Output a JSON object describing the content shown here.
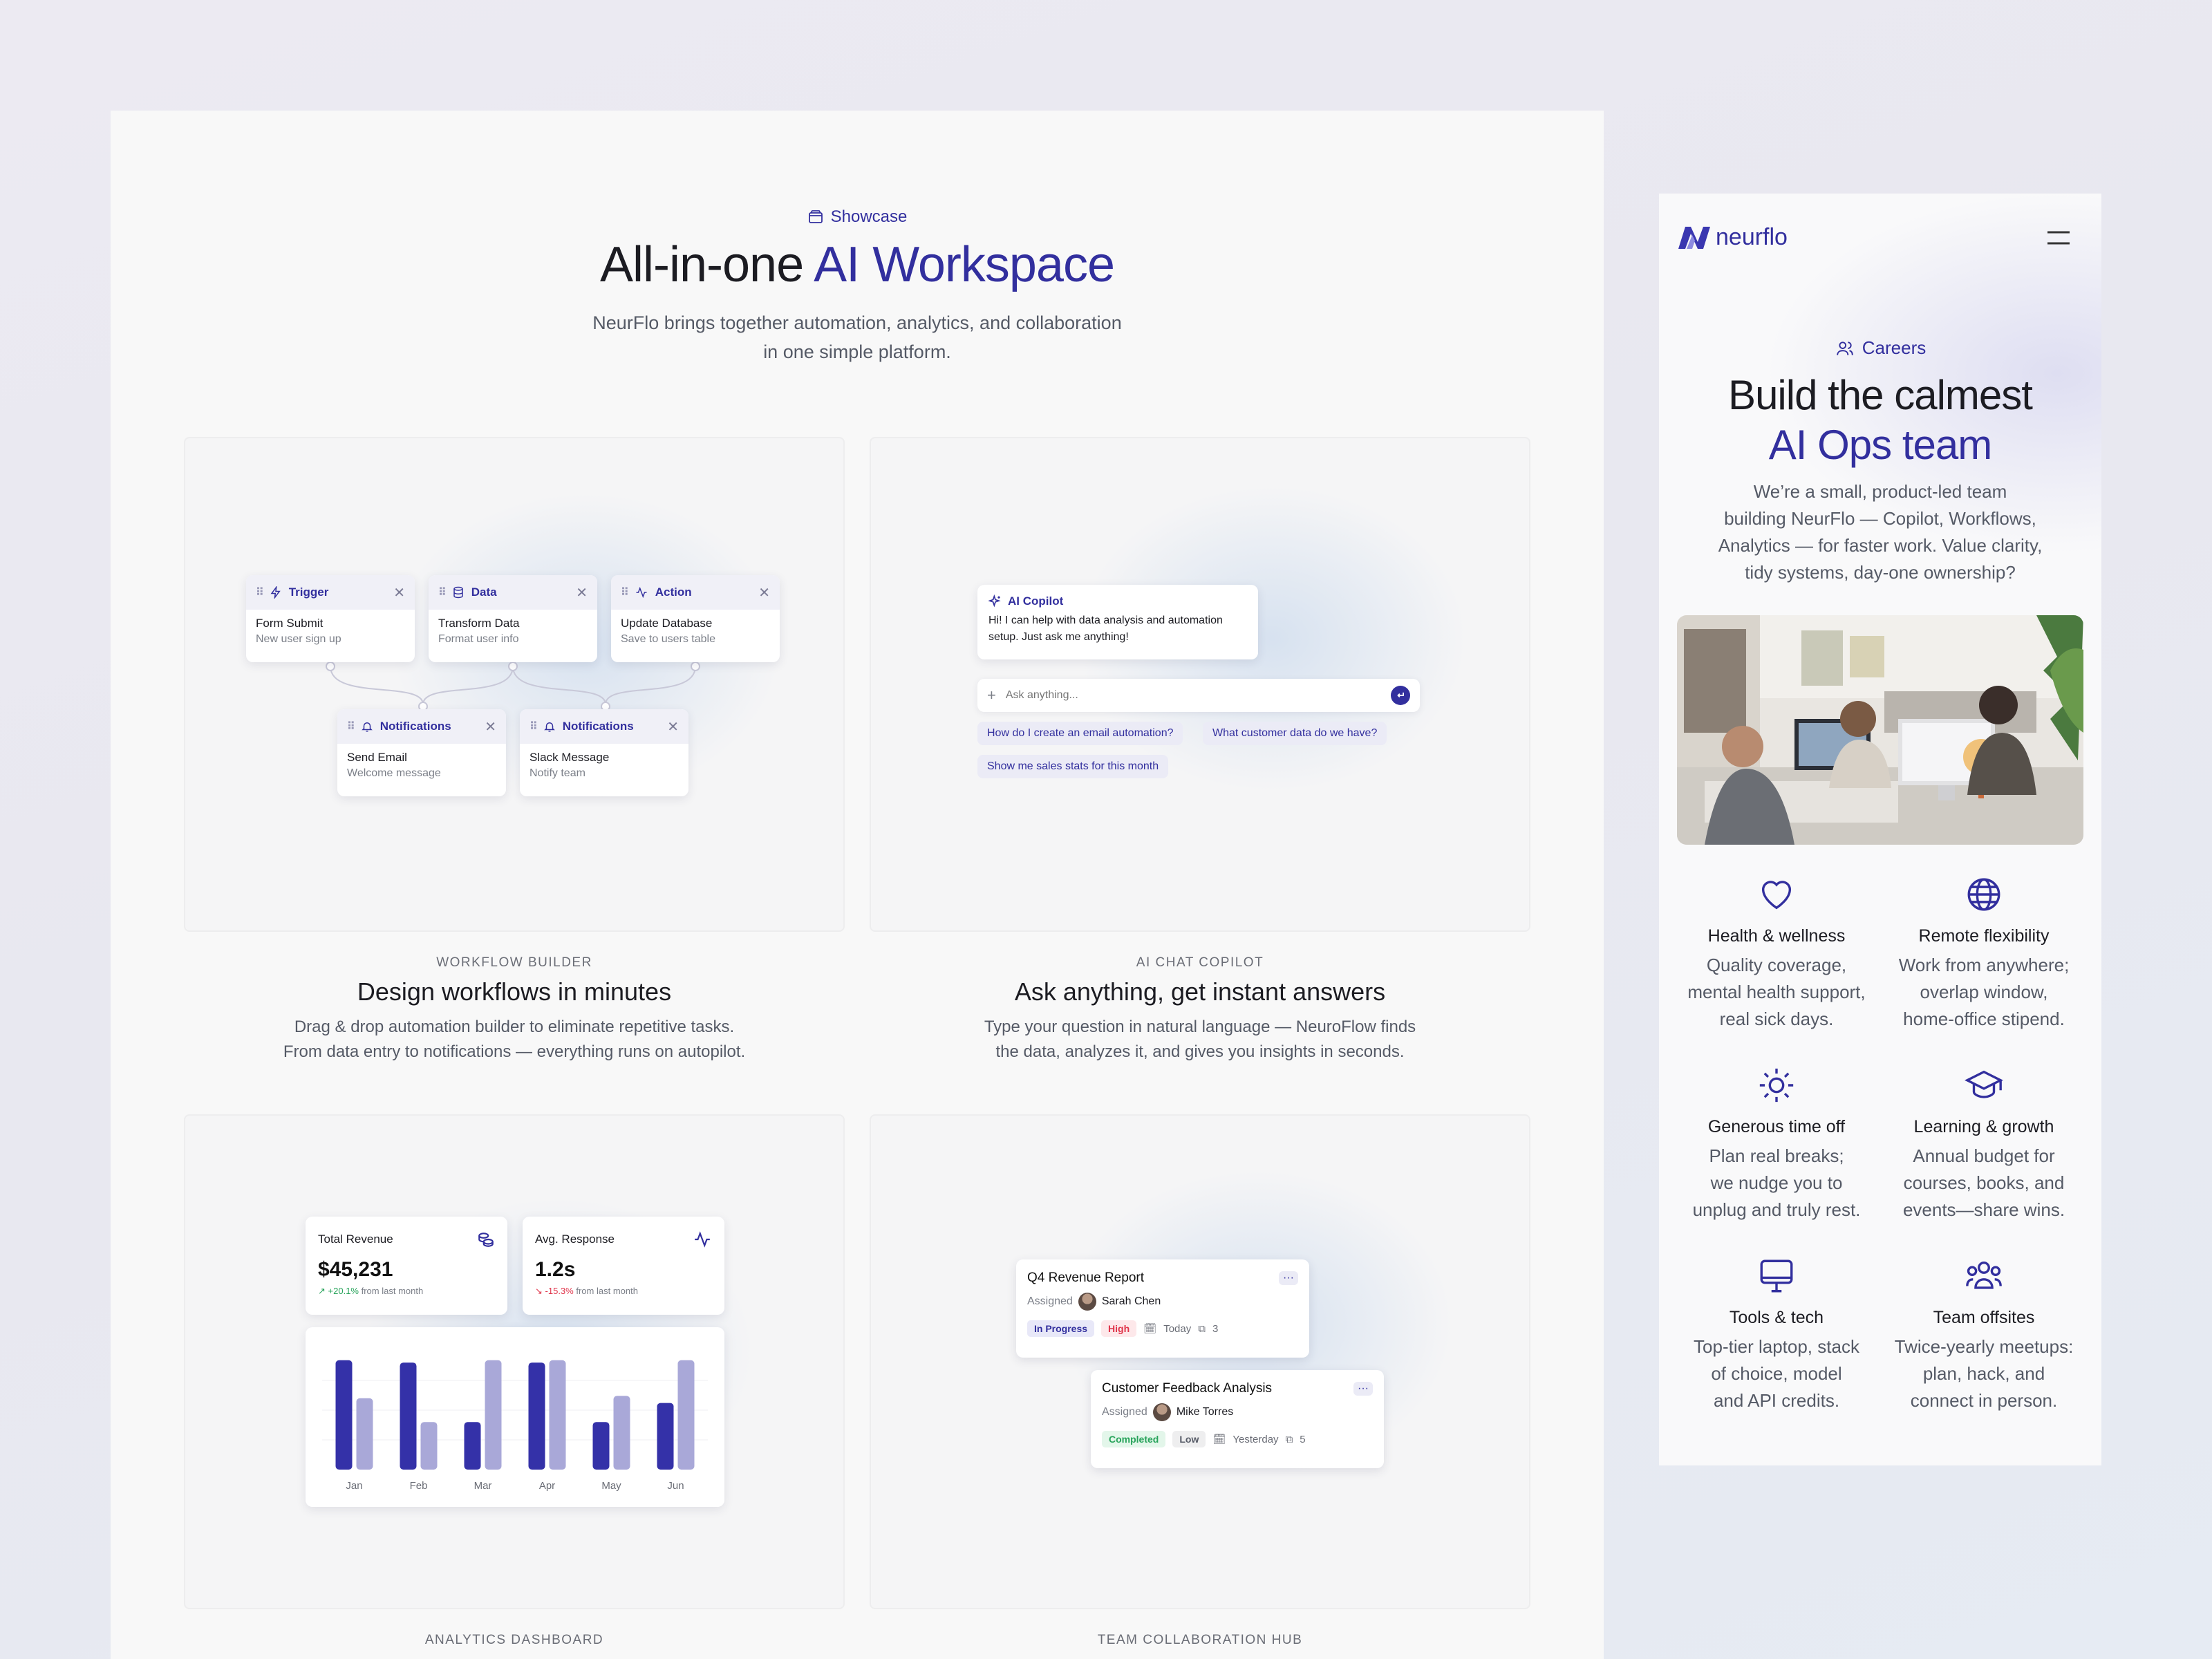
{
  "colors": {
    "accent": "#322f9e",
    "bar_dark": "#3431a8",
    "bar_light": "#a9a8d8",
    "bg": "#f8f8f8"
  },
  "showcase": {
    "eyebrow": "Showcase",
    "title_plain": "All-in-one ",
    "title_accent": "AI Workspace",
    "subtitle_line1": "NeurFlo brings together automation, analytics, and collaboration",
    "subtitle_line2": "in one simple platform.",
    "features": [
      {
        "label": "WORKFLOW BUILDER",
        "title": "Design workflows in minutes",
        "desc1": "Drag & drop automation builder to eliminate repetitive tasks.",
        "desc2": "From data entry to notifications — everything runs on autopilot."
      },
      {
        "label": "AI CHAT COPILOT",
        "title": "Ask anything, get instant answers",
        "desc1": "Type your question in natural language — NeuroFlow finds",
        "desc2": "the data, analyzes it, and gives you insights in seconds."
      },
      {
        "label": "ANALYTICS DASHBOARD"
      },
      {
        "label": "TEAM COLLABORATION HUB"
      }
    ]
  },
  "workflow": {
    "nodes": [
      {
        "type": "Trigger",
        "icon": "bolt-icon",
        "title": "Form Submit",
        "sub": "New user sign up"
      },
      {
        "type": "Data",
        "icon": "database-icon",
        "title": "Transform Data",
        "sub": "Format user info"
      },
      {
        "type": "Action",
        "icon": "activity-icon",
        "title": "Update Database",
        "sub": "Save to users table"
      },
      {
        "type": "Notifications",
        "icon": "bell-icon",
        "title": "Send Email",
        "sub": "Welcome message"
      },
      {
        "type": "Notifications",
        "icon": "bell-icon",
        "title": "Slack Message",
        "sub": "Notify team"
      }
    ]
  },
  "chat": {
    "copilot_label": "AI Copilot",
    "message_line1": "Hi! I can help with data analysis and automation",
    "message_line2": "setup. Just ask me anything!",
    "input_placeholder": "Ask anything...",
    "suggestions": [
      "How do I create an email automation?",
      "What customer data do we have?",
      "Show me sales stats for this month"
    ]
  },
  "analytics": {
    "stats": [
      {
        "label": "Total Revenue",
        "value": "$45,231",
        "delta": "+20.1%",
        "delta_suffix": "from last month",
        "icon": "coins-icon"
      },
      {
        "label": "Avg. Response",
        "value": "1.2s",
        "delta": "-15.3%",
        "delta_suffix": "from last month",
        "icon": "pulse-icon"
      }
    ]
  },
  "chart_data": {
    "type": "bar",
    "categories": [
      "Jan",
      "Feb",
      "Mar",
      "Apr",
      "May",
      "Jun"
    ],
    "series": [
      {
        "values": [
          92,
          90,
          40,
          90,
          40,
          56
        ]
      },
      {
        "values": [
          60,
          40,
          92,
          92,
          62,
          92
        ]
      }
    ],
    "ylim": [
      0,
      100
    ],
    "grid": true,
    "legend": "none"
  },
  "tasks": [
    {
      "title": "Q4 Revenue Report",
      "assigned_label": "Assigned",
      "assignee": "Sarah Chen",
      "status": "In Progress",
      "priority": "High",
      "due": "Today",
      "comments": "3"
    },
    {
      "title": "Customer Feedback Analysis",
      "assigned_label": "Assigned",
      "assignee": "Mike Torres",
      "status": "Completed",
      "priority": "Low",
      "due": "Yesterday",
      "comments": "5"
    }
  ],
  "mobile": {
    "brand": "neurflo",
    "eyebrow": "Careers",
    "title_line1": "Build the calmest",
    "title_line2": "AI Ops team",
    "intro": [
      "We’re a small, product-led team",
      "building NeurFlo — Copilot, Workflows,",
      "Analytics — for faster work. Value clarity,",
      "tidy systems, day-one ownership?"
    ],
    "photo_alt": "team working at computers in an office",
    "benefits": [
      {
        "icon": "heart-icon",
        "title": "Health & wellness",
        "lines": [
          "Quality coverage,",
          "mental health support,",
          "real sick days."
        ]
      },
      {
        "icon": "globe-icon",
        "title": "Remote flexibility",
        "lines": [
          "Work from anywhere;",
          "overlap window,",
          "home-office stipend."
        ]
      },
      {
        "icon": "sun-icon",
        "title": "Generous time off",
        "lines": [
          "Plan real breaks;",
          "we nudge you to",
          "unplug and truly rest."
        ]
      },
      {
        "icon": "graduation-cap-icon",
        "title": "Learning & growth",
        "lines": [
          "Annual budget for",
          "courses, books, and",
          "events—share wins."
        ]
      },
      {
        "icon": "monitor-icon",
        "title": "Tools & tech",
        "lines": [
          "Top-tier laptop, stack",
          "of choice, model",
          "and API credits."
        ]
      },
      {
        "icon": "team-icon",
        "title": "Team offsites",
        "lines": [
          "Twice-yearly meetups:",
          "plan, hack, and",
          "connect in person."
        ]
      }
    ]
  }
}
